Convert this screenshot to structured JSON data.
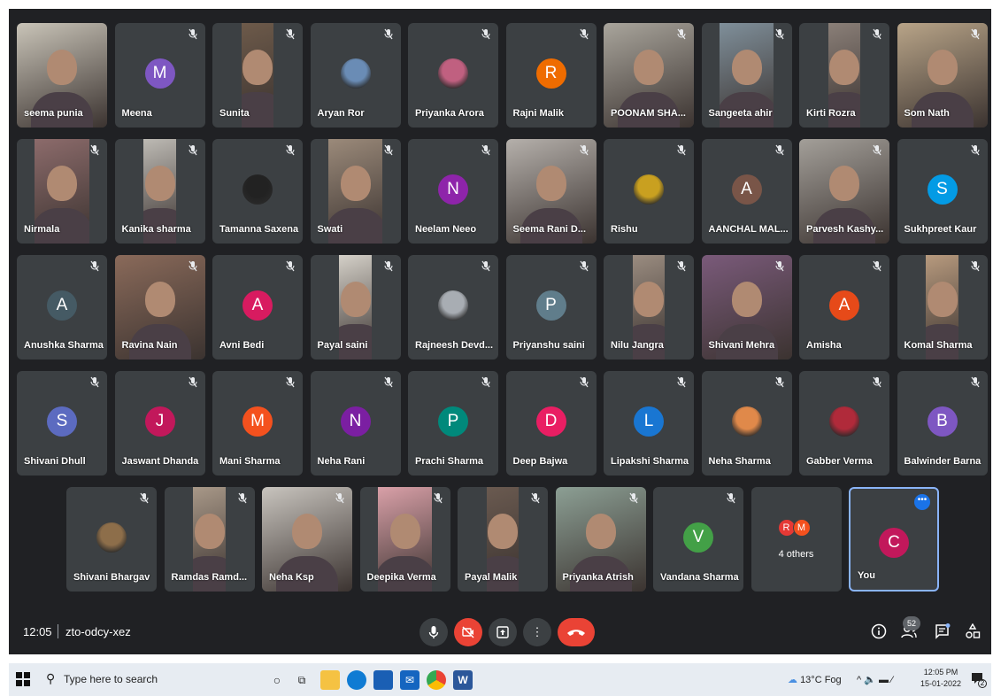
{
  "meeting": {
    "time": "12:05",
    "code": "zto-odcy-xez",
    "participant_count": "52",
    "self_label": "You",
    "self_initial": "C",
    "others_label": "4 others",
    "others_initials": [
      "R",
      "M"
    ]
  },
  "rows": [
    [
      {
        "name": "seema punia",
        "type": "video",
        "tone": "#c9c4b8",
        "muted": false
      },
      {
        "name": "Meena",
        "type": "letter",
        "letter": "M",
        "color": "#7e57c2",
        "muted": true
      },
      {
        "name": "Sunita",
        "type": "video",
        "tone": "#6d5a4a",
        "muted": true
      },
      {
        "name": "Aryan Ror",
        "type": "photo",
        "tone": "#6a8cb5",
        "muted": true
      },
      {
        "name": "Priyanka Arora",
        "type": "photo",
        "tone": "#c06080",
        "muted": true
      },
      {
        "name": "Rajni Malik",
        "type": "letter",
        "letter": "R",
        "color": "#ef6c00",
        "muted": true
      },
      {
        "name": "POONAM SHA...",
        "type": "video",
        "tone": "#a9a59c",
        "muted": true
      },
      {
        "name": "Sangeeta ahir",
        "type": "video",
        "tone": "#7f8f9a",
        "muted": true
      },
      {
        "name": "Kirti Rozra",
        "type": "video",
        "tone": "#8a7f78",
        "muted": true
      },
      {
        "name": "Som Nath",
        "type": "video",
        "tone": "#b8a488",
        "muted": true
      }
    ],
    [
      {
        "name": "Nirmala",
        "type": "video",
        "tone": "#8c6b6b",
        "muted": true
      },
      {
        "name": "Kanika sharma",
        "type": "video",
        "tone": "#bdbab4",
        "muted": true
      },
      {
        "name": "Tamanna Saxena",
        "type": "photo",
        "tone": "#222",
        "muted": true
      },
      {
        "name": "Swati",
        "type": "video",
        "tone": "#9b8a7a",
        "muted": true
      },
      {
        "name": "Neelam Neeo",
        "type": "letter",
        "letter": "N",
        "color": "#8e24aa",
        "muted": true
      },
      {
        "name": "Seema Rani D...",
        "type": "video",
        "tone": "#b5b0ab",
        "muted": true
      },
      {
        "name": "Rishu",
        "type": "photo",
        "tone": "#c9a020",
        "muted": true
      },
      {
        "name": "AANCHAL MAL...",
        "type": "letter",
        "letter": "A",
        "color": "#795548",
        "muted": true
      },
      {
        "name": "Parvesh Kashy...",
        "type": "video",
        "tone": "#a39f99",
        "muted": true
      },
      {
        "name": "Sukhpreet Kaur",
        "type": "letter",
        "letter": "S",
        "color": "#039be5",
        "muted": true
      }
    ],
    [
      {
        "name": "Anushka Sharma",
        "type": "letter",
        "letter": "A",
        "color": "#455a64",
        "muted": true
      },
      {
        "name": "Ravina Nain",
        "type": "video",
        "tone": "#8a6a5a",
        "muted": true
      },
      {
        "name": "Avni Bedi",
        "type": "letter",
        "letter": "A",
        "color": "#d81b60",
        "muted": true
      },
      {
        "name": "Payal saini",
        "type": "video",
        "tone": "#d4d0c8",
        "muted": true
      },
      {
        "name": "Rajneesh Devd...",
        "type": "photo",
        "tone": "#a8adb3",
        "muted": true
      },
      {
        "name": "Priyanshu saini",
        "type": "letter",
        "letter": "P",
        "color": "#607d8b",
        "muted": true
      },
      {
        "name": "Nilu Jangra",
        "type": "video",
        "tone": "#9a8c80",
        "muted": true
      },
      {
        "name": "Shivani Mehra",
        "type": "video",
        "tone": "#7a5a7a",
        "muted": true
      },
      {
        "name": "Amisha",
        "type": "letter",
        "letter": "A",
        "color": "#e64a19",
        "muted": true
      },
      {
        "name": "Komal Sharma",
        "type": "video",
        "tone": "#b79a7e",
        "muted": true
      }
    ],
    [
      {
        "name": "Shivani Dhull",
        "type": "letter",
        "letter": "S",
        "color": "#5c6bc0",
        "muted": true
      },
      {
        "name": "Jaswant Dhanda",
        "type": "letter",
        "letter": "J",
        "color": "#c2185b",
        "muted": true
      },
      {
        "name": "Mani Sharma",
        "type": "letter",
        "letter": "M",
        "color": "#f4511e",
        "muted": true
      },
      {
        "name": "Neha Rani",
        "type": "letter",
        "letter": "N",
        "color": "#7b1fa2",
        "muted": true
      },
      {
        "name": "Prachi Sharma",
        "type": "letter",
        "letter": "P",
        "color": "#00897b",
        "muted": true
      },
      {
        "name": "Deep Bajwa",
        "type": "letter",
        "letter": "D",
        "color": "#e91e63",
        "muted": true
      },
      {
        "name": "Lipakshi Sharma",
        "type": "letter",
        "letter": "L",
        "color": "#1976d2",
        "muted": true
      },
      {
        "name": "Neha Sharma",
        "type": "photo",
        "tone": "#e0894a",
        "muted": true
      },
      {
        "name": "Gabber Verma",
        "type": "photo",
        "tone": "#b02a3a",
        "muted": true
      },
      {
        "name": "Balwinder Barna",
        "type": "letter",
        "letter": "B",
        "color": "#7e57c2",
        "muted": true
      }
    ],
    [
      {
        "name": "Shivani Bhargav",
        "type": "photo",
        "tone": "#8d6e4a",
        "muted": true
      },
      {
        "name": "Ramdas Ramd...",
        "type": "video",
        "tone": "#a89888",
        "muted": true
      },
      {
        "name": "Neha Ksp",
        "type": "video",
        "tone": "#c8c4be",
        "muted": true
      },
      {
        "name": "Deepika Verma",
        "type": "video",
        "tone": "#d9a0a8",
        "muted": true
      },
      {
        "name": "Payal Malik",
        "type": "video",
        "tone": "#6a5a50",
        "muted": true
      },
      {
        "name": "Priyanka Atrish",
        "type": "video",
        "tone": "#8c9f94",
        "muted": true
      },
      {
        "name": "Vandana Sharma",
        "type": "letter",
        "letter": "V",
        "color": "#43a047",
        "muted": true
      }
    ]
  ],
  "controls": {
    "mic": "🎤",
    "camera_off": "⊘",
    "present": "⇧",
    "more": "⋮",
    "hangup": "☎"
  },
  "taskbar": {
    "search_placeholder": "Type here to search",
    "weather": "13°C Fog",
    "tray": "^ 🔈 ▬ ⁄",
    "clock_time": "12:05 PM",
    "clock_date": "15-01-2022",
    "notif_count": "2"
  }
}
